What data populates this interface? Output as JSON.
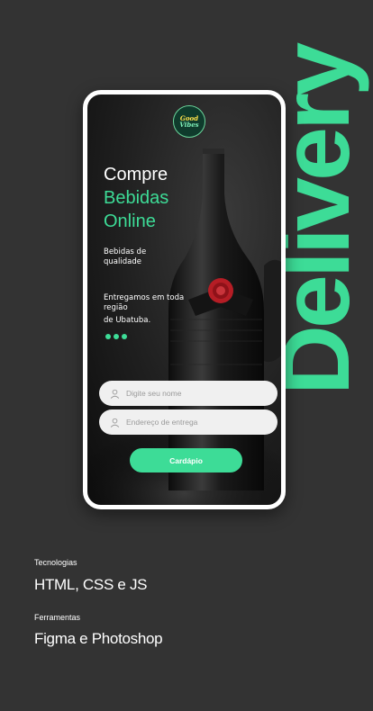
{
  "banner": {
    "word": "Delivery"
  },
  "phone": {
    "logo": {
      "line1": "Good",
      "line2": "Vibes"
    },
    "headline": {
      "line1": "Compre",
      "line2": "Bebidas",
      "line3": "Online"
    },
    "subtitle": "Bebidas de qualidade",
    "delivery_text": {
      "line1": "Entregamos em toda região",
      "line2": "de Ubatuba."
    },
    "form": {
      "name_placeholder": "Digite seu nome",
      "address_placeholder": "Endereço de entrega",
      "button_label": "Cardápio"
    }
  },
  "info": [
    {
      "label": "Tecnologias",
      "value": "HTML, CSS e JS"
    },
    {
      "label": "Ferramentas",
      "value": "Figma e Photoshop"
    }
  ],
  "colors": {
    "accent": "#3ddc97",
    "background": "#333333"
  }
}
